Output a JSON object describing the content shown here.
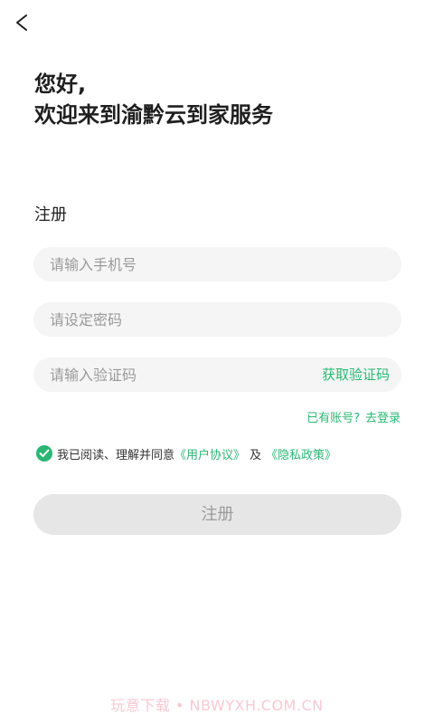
{
  "header": {
    "back_icon": "chevron-left-icon"
  },
  "greeting": {
    "line1": "您好,",
    "line2": "欢迎来到渝黔云到家服务"
  },
  "form": {
    "title": "注册",
    "phone_placeholder": "请输入手机号",
    "password_placeholder": "请设定密码",
    "code_placeholder": "请输入验证码",
    "get_code_label": "获取验证码",
    "has_account_label": "已有账号?",
    "login_label": "去登录"
  },
  "agreement": {
    "checked": true,
    "text": "我已阅读、理解并同意",
    "user_agreement": "《用户协议》",
    "and_text": "及",
    "privacy_policy": "《隐私政策》"
  },
  "submit": {
    "label": "注册"
  },
  "watermark": {
    "text": "玩意下载 • NBWYXH.COM.CN"
  },
  "colors": {
    "accent": "#2bb673",
    "input_bg": "#f5f5f5",
    "button_disabled_bg": "#e6e6e6",
    "button_disabled_text": "#9a9a9a"
  }
}
